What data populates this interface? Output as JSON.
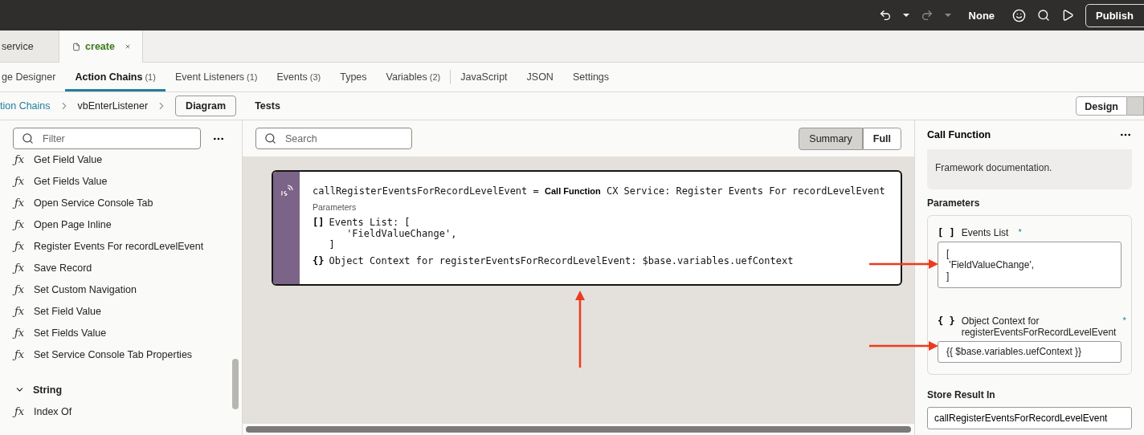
{
  "top_bar": {
    "history": [
      {
        "kind": "undo",
        "disabled": false
      },
      {
        "kind": "redo",
        "disabled": true
      }
    ],
    "mode_label": "None",
    "publish": "Publish"
  },
  "file_tabs": [
    {
      "label": "service",
      "selected": false
    },
    {
      "label": "create",
      "selected": true
    }
  ],
  "nav_tabs": [
    {
      "label": "ge Designer",
      "selected": false
    },
    {
      "label": "Action Chains",
      "count": "(1)",
      "selected": true
    },
    {
      "label": "Event Listeners",
      "count": "(1)",
      "selected": false
    },
    {
      "label": "Events",
      "count": "(3)",
      "selected": false
    },
    {
      "label": "Types",
      "selected": false
    },
    {
      "label": "Variables",
      "count": "(2)",
      "selected": false
    },
    {
      "label": "JavaScript",
      "selected": false,
      "separator_before": true
    },
    {
      "label": "JSON",
      "selected": false
    },
    {
      "label": "Settings",
      "selected": false
    }
  ],
  "breadcrumb": [
    {
      "label": "tion Chains",
      "kind": "link"
    },
    {
      "label": "vbEnterListener",
      "kind": "text"
    }
  ],
  "view_tabs": [
    {
      "label": "Diagram",
      "selected": true
    },
    {
      "label": "Tests",
      "selected": false
    }
  ],
  "editor_modes": [
    {
      "label": "Design",
      "selected": false
    },
    {
      "selected": true
    }
  ],
  "left_panel": {
    "filter": {
      "placeholder": "Filter"
    },
    "items": [
      {
        "kind": "function",
        "symbol": "ƒx",
        "label": "Get Field Value"
      },
      {
        "kind": "function",
        "symbol": "ƒx",
        "label": "Get Fields Value"
      },
      {
        "kind": "function",
        "symbol": "ƒx",
        "label": "Open Service Console Tab"
      },
      {
        "kind": "function",
        "symbol": "ƒx",
        "label": "Open Page Inline"
      },
      {
        "kind": "function",
        "symbol": "ƒx",
        "label": "Register Events For recordLevelEvent"
      },
      {
        "kind": "function",
        "symbol": "ƒx",
        "label": "Save Record"
      },
      {
        "kind": "function",
        "symbol": "ƒx",
        "label": "Set Custom Navigation"
      },
      {
        "kind": "function",
        "symbol": "ƒx",
        "label": "Set Field Value"
      },
      {
        "kind": "function",
        "symbol": "ƒx",
        "label": "Set Fields Value"
      },
      {
        "kind": "function",
        "symbol": "ƒx",
        "label": "Set Service Console Tab Properties"
      },
      {
        "kind": "group",
        "label": "String",
        "expanded": true,
        "children": [
          {
            "kind": "function",
            "symbol": "ƒx",
            "label": "Index Of"
          }
        ]
      }
    ]
  },
  "canvas": {
    "search": {
      "placeholder": "Search"
    },
    "view_toggle": [
      {
        "label": "Summary",
        "selected": true
      },
      {
        "label": "Full",
        "selected": false
      }
    ],
    "node": {
      "variable": "callRegisterEventsForRecordLevelEvent",
      "operator": "=",
      "action": "Call Function",
      "target": "CX Service: Register Events For recordLevelEvent",
      "params_label": "Parameters",
      "params": [
        {
          "symbol": "[]",
          "text": "Events List: [\n   'FieldValueChange',\n]"
        },
        {
          "symbol": "{}",
          "text": "Object Context for registerEventsForRecordLevelEvent: $base.variables.uefContext"
        }
      ]
    }
  },
  "right_panel": {
    "title": "Call Function",
    "description": "Framework documentation.",
    "params_label": "Parameters",
    "params": [
      {
        "kind": "textarea",
        "symbol": "[ ]",
        "label": "Events List",
        "required_mark": "*",
        "value": "[\n 'FieldValueChange',\n]"
      },
      {
        "kind": "input",
        "symbol": "{ }",
        "label": "Object Context for registerEventsForRecordLevelEvent",
        "required_mark": "*",
        "value": "{{ $base.variables.uefContext }}"
      }
    ],
    "store_label": "Store Result In",
    "store_value": "callRegisterEventsForRecordLevelEvent"
  }
}
